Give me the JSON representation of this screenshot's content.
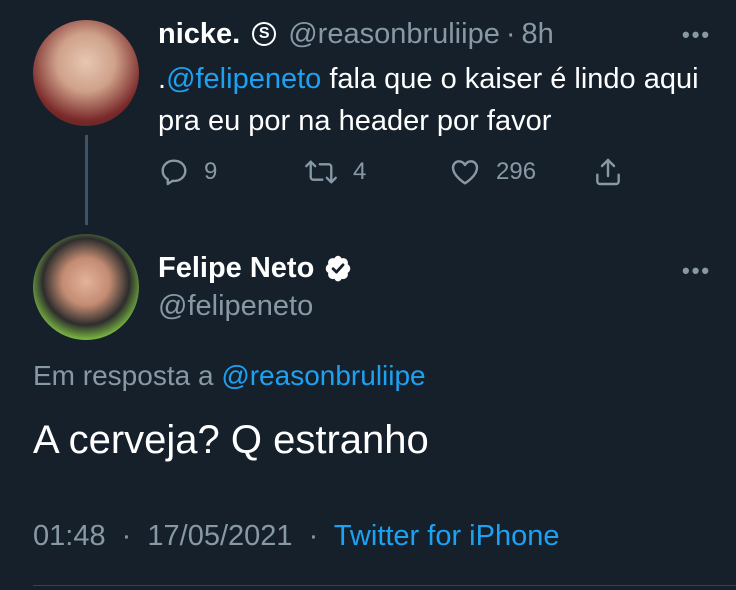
{
  "parent_tweet": {
    "display_name": "nicke.",
    "badge": "S",
    "handle": "@reasonbruliipe",
    "separator": "·",
    "time": "8h",
    "text_prefix": ".",
    "mention": "@felipeneto",
    "text_rest": " fala que o kaiser é lindo aqui pra eu por na header por favor",
    "more_label": "•••",
    "actions": {
      "reply_count": "9",
      "retweet_count": "4",
      "like_count": "296"
    }
  },
  "main_tweet": {
    "display_name": "Felipe Neto",
    "handle": "@felipeneto",
    "more_label": "•••",
    "reply_prefix": "Em resposta a ",
    "reply_handle": "@reasonbruliipe",
    "text": "A cerveja? Q estranho",
    "time": "01:48",
    "date": "17/05/2021",
    "separator": "·",
    "source": "Twitter for iPhone"
  },
  "colors": {
    "background": "#15202b",
    "accent": "#1da1f2",
    "muted": "#8899a6",
    "thread_line": "#3d5466"
  },
  "icons": [
    "reply-icon",
    "retweet-icon",
    "like-icon",
    "share-icon",
    "verified-badge-icon",
    "more-icon"
  ]
}
